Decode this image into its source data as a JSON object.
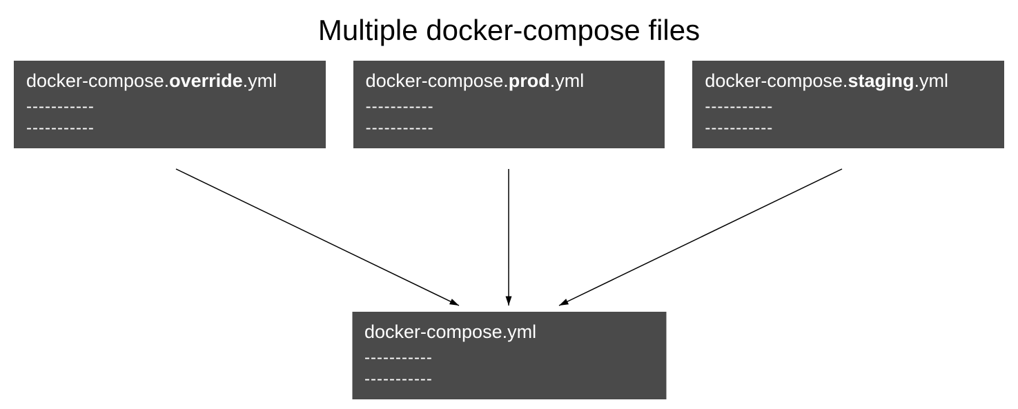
{
  "title": "Multiple docker-compose files",
  "files": {
    "top": [
      {
        "prefix": "docker-compose.",
        "bold": "override",
        "suffix": ".yml",
        "dashes1": "-----------",
        "dashes2": "-----------"
      },
      {
        "prefix": "docker-compose.",
        "bold": "prod",
        "suffix": ".yml",
        "dashes1": "-----------",
        "dashes2": "-----------"
      },
      {
        "prefix": "docker-compose.",
        "bold": "staging",
        "suffix": ".yml",
        "dashes1": "-----------",
        "dashes2": "-----------"
      }
    ],
    "bottom": {
      "name": "docker-compose.yml",
      "dashes1": "-----------",
      "dashes2": "-----------"
    }
  }
}
